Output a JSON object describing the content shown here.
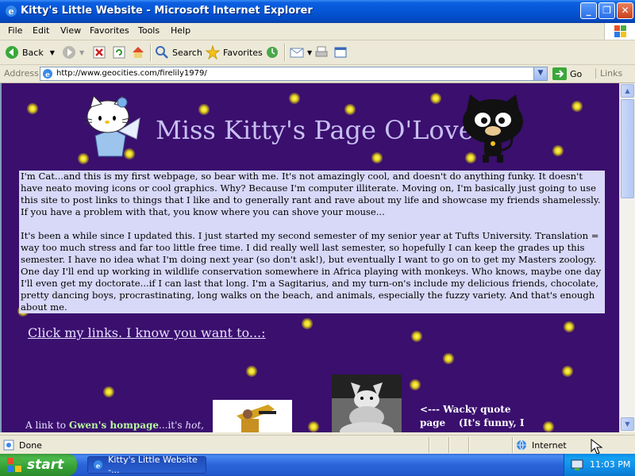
{
  "window": {
    "title": "Kitty's Little Website - Microsoft Internet Explorer",
    "minimize_label": "_",
    "maximize_label": "❐",
    "close_label": "✕"
  },
  "menu": [
    "File",
    "Edit",
    "View",
    "Favorites",
    "Tools",
    "Help"
  ],
  "toolbar": {
    "back_label": "Back",
    "search_label": "Search",
    "favorites_label": "Favorites"
  },
  "address": {
    "label": "Address",
    "url": "http://www.geocities.com/firelily1979/",
    "go_label": "Go",
    "links_label": "Links"
  },
  "page": {
    "title": "Miss Kitty's Page O'Love",
    "intro_p1": "I'm Cat...and this is my first webpage, so bear with me.  It's not amazingly cool, and doesn't do anything funky.  It doesn't have neato moving icons or cool graphics.  Why?  Because I'm computer illiterate.  Moving on, I'm basically just going to use this site to post links to things that I like and to generally rant and rave about my life and showcase my friends shamelessly.  If you have a problem with that, you know where you can shove your mouse...",
    "intro_p2": "It's been a while since I updated this.  I just started my second semester of my senior year at Tufts University.  Translation = way too much stress and far too little free time.  I did really well last semester, so hopefully I can keep the grades up this semester.  I have no idea what I'm doing next year (so don't ask!), but eventually I want to go on to get my Masters zoology.  One day I'll end up working in wildlife conservation somewhere in Africa playing with monkeys.  Who knows, maybe one day I'll even get my doctorate...if I can last that long.  I'm a Sagitarius, and my turn-on's include my delicious friends, chocolate, pretty dancing boys, procrastinating, long walks on the beach, and animals, especially the fuzzy variety.  And that's enough about me.",
    "links_heading": "Click my links.  I know you want to...:",
    "gwen_prefix": "A link to ",
    "gwen_link": "Gwen's hompage",
    "gwen_suffix": "...it's ",
    "gwen_italic": "hot,",
    "quote_line1": "<--- Wacky quote",
    "quote_line2": "page    (It's funny, I"
  },
  "status": {
    "text": "Done",
    "zone": "Internet"
  },
  "taskbar": {
    "start_label": "start",
    "task_label": "Kitty's Little Website -...",
    "clock": "11:03 PM"
  },
  "colors": {
    "page_background": "#3a0f6e",
    "intro_background": "#d8d8f8",
    "title_color": "#c8c0f0",
    "link_green": "#b8f8a0"
  }
}
